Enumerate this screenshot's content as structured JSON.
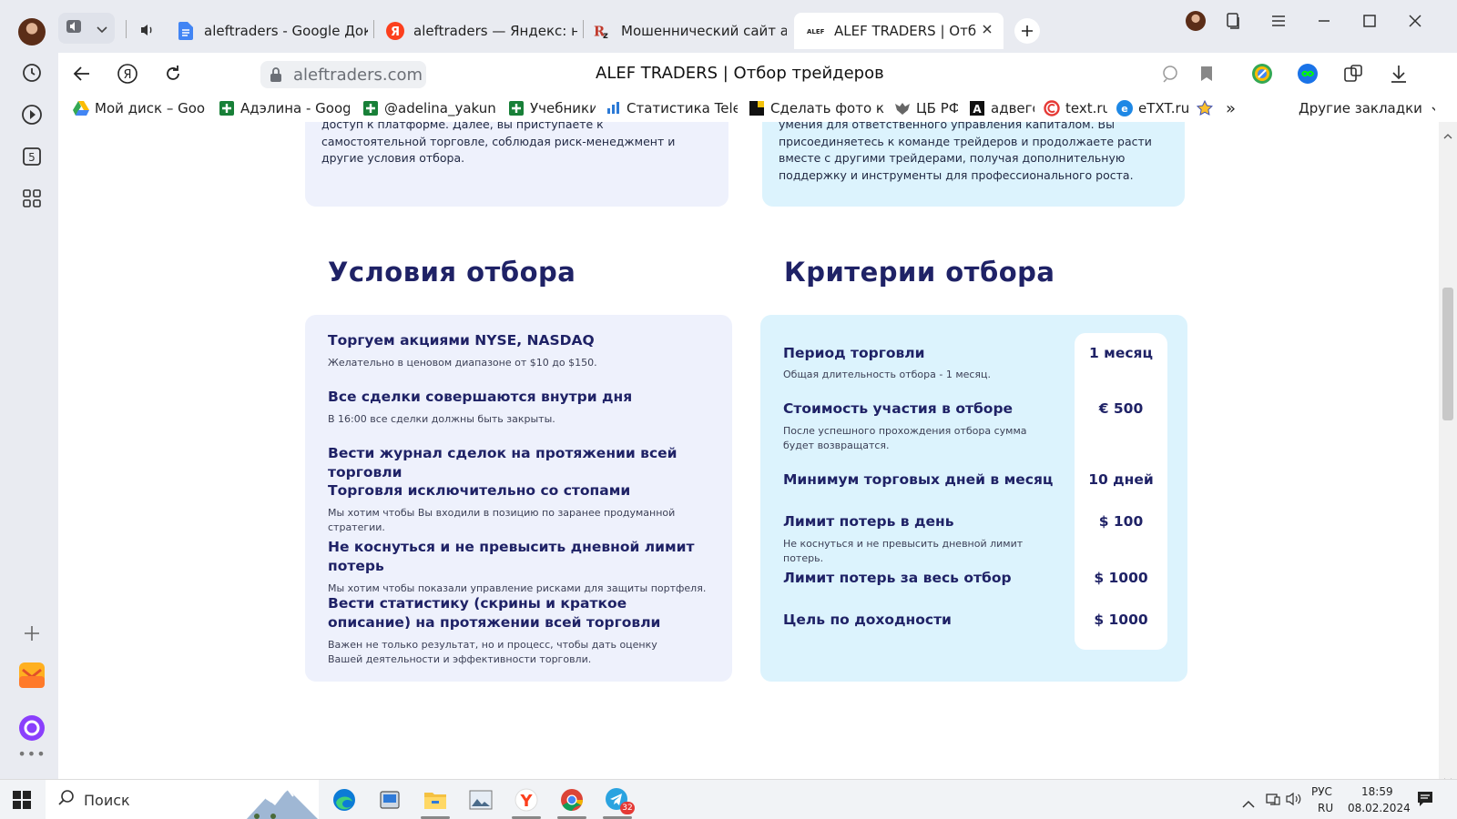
{
  "browser": {
    "tabs": [
      {
        "label": "aleftraders - Google Документы",
        "icon": "google-docs-icon"
      },
      {
        "label": "aleftraders — Яндекс: нашлось",
        "icon": "yandex-icon"
      },
      {
        "label": "Мошеннический сайт aleftraders",
        "icon": "rz-icon"
      },
      {
        "label": "ALEF TRADERS | Отбор трейдеров",
        "icon": "alef-icon",
        "active": true
      }
    ],
    "url": "aleftraders.com",
    "page_title": "ALEF TRADERS | Отбор трейдеров",
    "bookmarks": [
      {
        "label": "Мой диск – Google Диск",
        "icon": "google-drive-icon"
      },
      {
        "label": "Адэлина - Google",
        "icon": "sheets-icon"
      },
      {
        "label": "@adelina_yakunina",
        "icon": "sheets-icon"
      },
      {
        "label": "Учебники",
        "icon": "sheets-icon"
      },
      {
        "label": "Статистика Telegram",
        "icon": "chart-icon"
      },
      {
        "label": "Сделать фото круглым",
        "icon": "photo-icon"
      },
      {
        "label": "ЦБ РФ",
        "icon": "eagle-icon"
      },
      {
        "label": "адвего",
        "icon": "advego-icon"
      },
      {
        "label": "text.ru",
        "icon": "textru-icon"
      },
      {
        "label": "eTXT.ru",
        "icon": "etxt-icon"
      }
    ],
    "more_label": "»",
    "other_bookmarks": "Другие закладки"
  },
  "content": {
    "left_card_text": "доступ к платформе. Далее, вы приступаете к самостоятельной торговле, соблюдая риск-менеджмент и другие условия отбора.",
    "right_card_text": "умения для ответственного управления капиталом. Вы присоединяетесь к команде трейдеров и продолжаете расти вместе с другими трейдерами, получая дополнительную поддержку и инструменты для профессионального роста.",
    "conditions_title": "Условия отбора",
    "criteria_title": "Критерии отбора",
    "conditions": [
      {
        "title": "Торгуем акциями NYSE, NASDAQ",
        "desc": "Желательно в ценовом диапазоне от $10 до $150."
      },
      {
        "title": "Все сделки совершаются внутри дня",
        "desc": "В 16:00 все сделки должны быть закрыты."
      },
      {
        "title": "Вести журнал сделок на протяжении всей торговли",
        "desc": ""
      },
      {
        "title": "Торговля исключительно со стопами",
        "desc": "Мы хотим чтобы Вы входили в позицию по заранее продуманной стратегии."
      },
      {
        "title": "Не коснуться и не превысить дневной лимит потерь",
        "desc": "Мы хотим чтобы показали управление рисками для защиты портфеля."
      },
      {
        "title": "Вести статистику (скрины и краткое описание) на протяжении всей торговли",
        "desc": "Важен не только результат, но и процесс, чтобы дать оценку Вашей деятельности и эффективности торговли."
      }
    ],
    "criteria": [
      {
        "label": "Период торговли",
        "desc": "Общая длительность отбора - 1 месяц.",
        "value": "1 месяц"
      },
      {
        "label": "Стоимость участия в отборе",
        "desc": "После успешного прохождения отбора сумма будет возвращатся.",
        "value": "€ 500"
      },
      {
        "label": "Минимум торговых дней в месяц",
        "desc": "",
        "value": "10 дней"
      },
      {
        "label": "Лимит потерь в день",
        "desc": "Не коснуться и не превысить дневной лимит потерь.",
        "value": "$ 100"
      },
      {
        "label": "Лимит потерь за весь отбор",
        "desc": "",
        "value": "$ 1000"
      },
      {
        "label": "Цель по доходности",
        "desc": "",
        "value": "$ 1000"
      }
    ]
  },
  "taskbar": {
    "search_placeholder": "Поиск",
    "language_top": "РУС",
    "language_bottom": "RU",
    "time": "18:59",
    "date": "08.02.2024",
    "telegram_badge": "32"
  }
}
